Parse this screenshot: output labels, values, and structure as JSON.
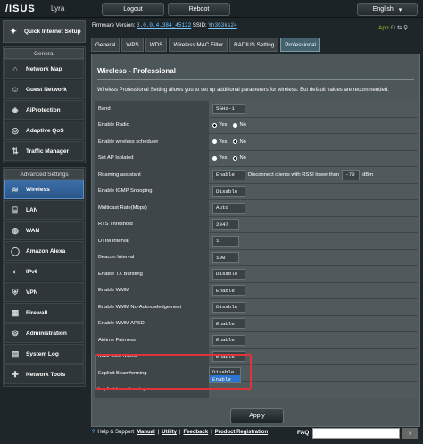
{
  "header": {
    "brand": "/ISUS",
    "model": "Lyra",
    "logout": "Logout",
    "reboot": "Reboot",
    "language": "English"
  },
  "status": {
    "firmware_label": "Firmware Version:",
    "firmware": "3.0.0.4.384_45122",
    "ssid_label": "SSID:",
    "ssid": "Yh3G3ks24",
    "app_label": "App"
  },
  "sidebar": {
    "qis": "Quick Internet Setup",
    "general_head": "General",
    "general": [
      "Network Map",
      "Guest Network",
      "AiProtection",
      "Adaptive QoS",
      "Traffic Manager"
    ],
    "advanced_head": "Advanced Settings",
    "advanced": [
      "Wireless",
      "LAN",
      "WAN",
      "Amazon Alexa",
      "IPv6",
      "VPN",
      "Firewall",
      "Administration",
      "System Log",
      "Network Tools"
    ]
  },
  "tabs": [
    "General",
    "WPS",
    "WDS",
    "Wireless MAC Filter",
    "RADIUS Setting",
    "Professional"
  ],
  "page": {
    "title": "Wireless - Professional",
    "description": "Wireless Professional Setting allows you to set up additional parameters for wireless. But default values are recommended."
  },
  "rows": {
    "band": {
      "label": "Band",
      "value": "5GHz-1"
    },
    "radio": {
      "label": "Enable Radio",
      "yes": "Yes",
      "no": "No"
    },
    "scheduler": {
      "label": "Enable wireless scheduler",
      "yes": "Yes",
      "no": "No"
    },
    "ap_isolated": {
      "label": "Set AP Isolated",
      "yes": "Yes",
      "no": "No"
    },
    "roaming": {
      "label": "Roaming assistant",
      "value": "Enable",
      "text": "Disconnect clients with RSSI lower than",
      "rssi": "-70",
      "unit": "dBm"
    },
    "igmp": {
      "label": "Enable IGMP Snooping",
      "value": "Disable"
    },
    "multicast": {
      "label": "Multicast Rate(Mbps)",
      "value": "Auto"
    },
    "rts": {
      "label": "RTS Threshold",
      "value": "2347"
    },
    "dtim": {
      "label": "DTIM Interval",
      "value": "1"
    },
    "beacon": {
      "label": "Beacon Interval",
      "value": "100"
    },
    "tx_burst": {
      "label": "Enable TX Bursting",
      "value": "Disable"
    },
    "wmm": {
      "label": "Enable WMM",
      "value": "Enable"
    },
    "wmm_noack": {
      "label": "Enable WMM No-Acknowledgement",
      "value": "Disable"
    },
    "wmm_apsd": {
      "label": "Enable WMM APSD",
      "value": "Enable"
    },
    "airtime": {
      "label": "Airtime Fairness",
      "value": "Enable"
    },
    "mu_mimo": {
      "label": "Multi-User MIMO",
      "value": "Enable"
    },
    "explicit_bf": {
      "label": "Explicit Beamforming",
      "options": [
        "Disable",
        "Enable"
      ]
    },
    "implicit_bf": {
      "label": "Implicit beamforming"
    }
  },
  "apply": "Apply",
  "footer": {
    "help": "Help & Support",
    "manual": "Manual",
    "utility": "Utility",
    "feedback": "Feedback",
    "product_registration": "Product Registration",
    "faq": "FAQ",
    "sep": "|"
  }
}
